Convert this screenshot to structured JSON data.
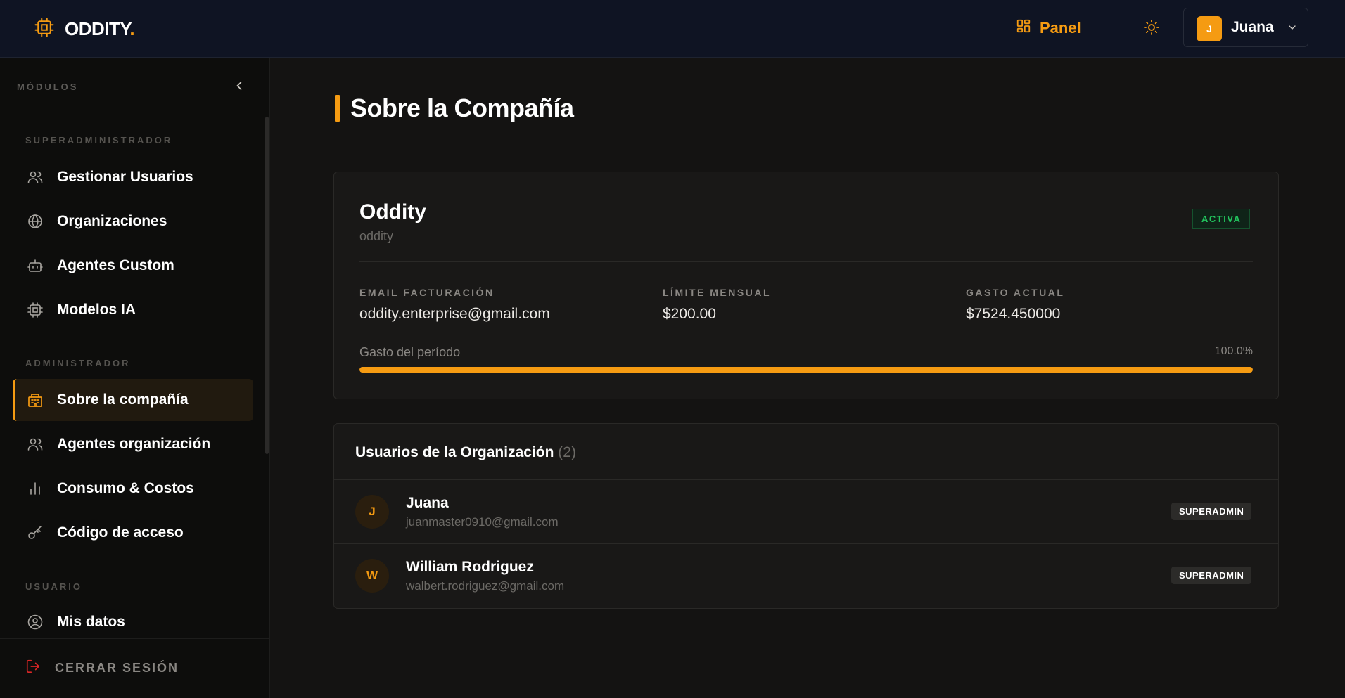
{
  "header": {
    "brand": "ODDITY",
    "brand_dot": ".",
    "panel_label": "Panel",
    "user_initial": "J",
    "user_name": "Juana"
  },
  "sidebar": {
    "title": "MÓDULOS",
    "sections": [
      {
        "label": "SUPERADMINISTRADOR"
      },
      {
        "label": "ADMINISTRADOR"
      },
      {
        "label": "USUARIO"
      }
    ],
    "items": [
      {
        "label": "Gestionar Usuarios",
        "icon": "users-icon"
      },
      {
        "label": "Organizaciones",
        "icon": "globe-icon"
      },
      {
        "label": "Agentes Custom",
        "icon": "bot-icon"
      },
      {
        "label": "Modelos IA",
        "icon": "chip-icon"
      },
      {
        "label": "Sobre la compañía",
        "icon": "building-icon",
        "active": true
      },
      {
        "label": "Agentes organización",
        "icon": "users-icon"
      },
      {
        "label": "Consumo & Costos",
        "icon": "bar-chart-icon"
      },
      {
        "label": "Código de acceso",
        "icon": "key-icon"
      },
      {
        "label": "Mis datos",
        "icon": "user-circle-icon"
      }
    ],
    "logout": "CERRAR SESIÓN"
  },
  "main": {
    "title": "Sobre la Compañía",
    "org": {
      "name": "Oddity",
      "slug": "oddity",
      "status": "ACTIVA",
      "fields": [
        {
          "label": "EMAIL FACTURACIÓN",
          "value": "oddity.enterprise@gmail.com"
        },
        {
          "label": "LÍMITE MENSUAL",
          "value": "$200.00"
        },
        {
          "label": "GASTO ACTUAL",
          "value": "$7524.450000"
        }
      ],
      "spend_label": "Gasto del período",
      "spend_pct_text": "100.0%",
      "spend_fraction": 1.0
    },
    "users": {
      "title": "Usuarios de la Organización",
      "count": "(2)",
      "rows": [
        {
          "initial": "J",
          "name": "Juana",
          "email": "juanmaster0910@gmail.com",
          "role": "SUPERADMIN"
        },
        {
          "initial": "W",
          "name": "William Rodriguez",
          "email": "walbert.rodriguez@gmail.com",
          "role": "SUPERADMIN"
        }
      ]
    }
  },
  "colors": {
    "accent": "#f59b12",
    "active_green": "#22c55e",
    "logout_red": "#dc2626"
  }
}
